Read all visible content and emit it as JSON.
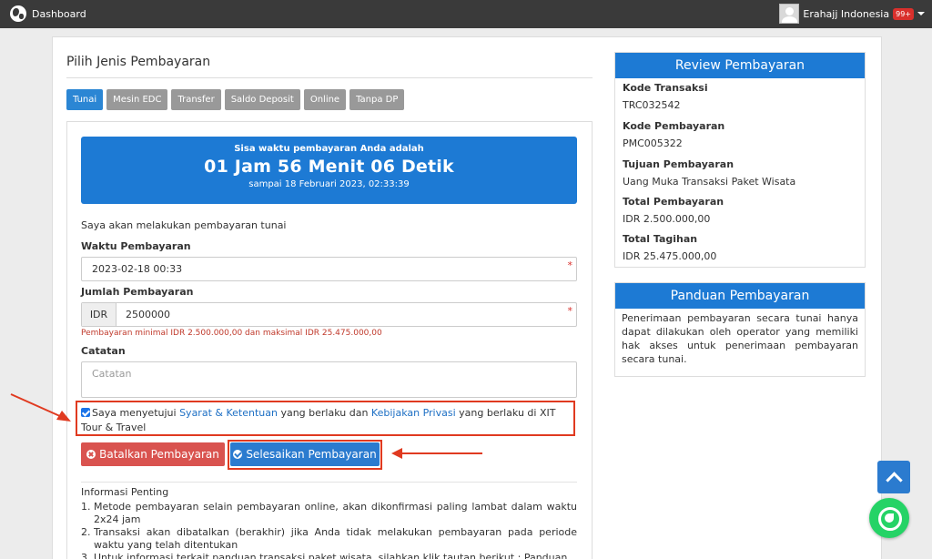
{
  "topbar": {
    "title": "Dashboard",
    "user_name": "Erahajj Indonesia",
    "notification_count": "99+"
  },
  "main": {
    "section_title": "Pilih Jenis Pembayaran",
    "tabs": [
      {
        "label": "Tunai",
        "active": true
      },
      {
        "label": "Mesin EDC",
        "active": false
      },
      {
        "label": "Transfer",
        "active": false
      },
      {
        "label": "Saldo Deposit",
        "active": false
      },
      {
        "label": "Online",
        "active": false
      },
      {
        "label": "Tanpa DP",
        "active": false
      }
    ],
    "timer": {
      "heading": "Sisa waktu pembayaran Anda adalah",
      "countdown": "01 Jam 56 Menit 06 Detik",
      "deadline": "sampai 18 Februari 2023, 02:33:39"
    },
    "intro": "Saya akan melakukan pembayaran tunai",
    "waktu_label": "Waktu Pembayaran",
    "waktu_value": "2023-02-18 00:33",
    "jumlah_label": "Jumlah Pembayaran",
    "jumlah_prefix": "IDR",
    "jumlah_value": "2500000",
    "jumlah_help": "Pembayaran minimal IDR 2.500.000,00 dan maksimal IDR 25.475.000,00",
    "catatan_label": "Catatan",
    "catatan_placeholder": "Catatan",
    "required_mark": "*",
    "agree": {
      "checked": true,
      "text_1": "Saya menyetujui ",
      "link_1": "Syarat & Ketentuan",
      "text_2": " yang berlaku dan ",
      "link_2": "Kebijakan Privasi",
      "text_3": " yang berlaku di XIT Tour & Travel"
    },
    "cancel_label": "Batalkan Pembayaran",
    "finish_label": "Selesaikan Pembayaran",
    "info_title": "Informasi Penting",
    "info_items": [
      "Metode pembayaran selain pembayaran online, akan dikonfirmasi paling lambat dalam waktu 2x24 jam",
      "Transaksi akan dibatalkan (berakhir) jika Anda tidak melakukan pembayaran pada periode waktu yang telah ditentukan",
      "Untuk informasi terkait panduan transaksi paket wisata, silahkan klik tautan berikut : Panduan"
    ]
  },
  "review": {
    "title": "Review Pembayaran",
    "kode_transaksi_label": "Kode Transaksi",
    "kode_transaksi": "TRC032542",
    "kode_pembayaran_label": "Kode Pembayaran",
    "kode_pembayaran": "PMC005322",
    "tujuan_label": "Tujuan Pembayaran",
    "tujuan": "Uang Muka Transaksi Paket Wisata",
    "total_pembayaran_label": "Total Pembayaran",
    "total_pembayaran": "IDR 2.500.000,00",
    "total_tagihan_label": "Total Tagihan",
    "total_tagihan": "IDR 25.475.000,00"
  },
  "guide": {
    "title": "Panduan Pembayaran",
    "text": "Penerimaan pembayaran secara tunai hanya dapat dilakukan oleh operator yang memiliki hak akses untuk penerimaan pembayaran secara tunai."
  },
  "colors": {
    "primary": "#1d7ad4",
    "danger": "#d9534f",
    "annotation": "#e03a20",
    "topbar": "#3a3a3a"
  },
  "icons": [
    "globe-icon",
    "avatar-icon",
    "caret-down-icon",
    "close-circle-icon",
    "check-circle-icon",
    "chevron-up-icon",
    "whatsapp-icon"
  ]
}
